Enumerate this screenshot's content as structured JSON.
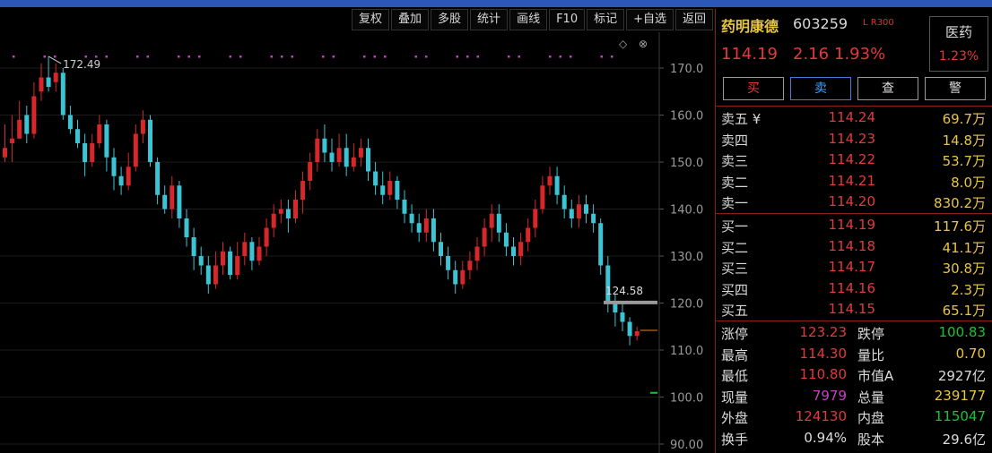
{
  "toolbar": [
    {
      "label": "复权",
      "icon": "",
      "name": "toolbar-fuquan-button"
    },
    {
      "label": "叠加",
      "icon": "",
      "name": "toolbar-overlay-button"
    },
    {
      "label": "多股",
      "icon": "",
      "name": "toolbar-multistock-button"
    },
    {
      "label": "统计",
      "icon": "",
      "name": "toolbar-stats-button"
    },
    {
      "label": "画线",
      "icon": "",
      "name": "toolbar-draw-button"
    },
    {
      "label": "F10",
      "icon": "",
      "name": "toolbar-f10-button"
    },
    {
      "label": "标记",
      "icon": "",
      "name": "toolbar-mark-button"
    },
    {
      "label": "自选",
      "icon": "+",
      "name": "toolbar-add-watchlist-button"
    },
    {
      "label": "返回",
      "icon": "",
      "name": "toolbar-back-button"
    }
  ],
  "chart_controls": {
    "diamond": "◇",
    "close": "⊗"
  },
  "chart_data": {
    "type": "candlestick",
    "y_ticks": [
      "170.0",
      "160.0",
      "150.0",
      "140.0",
      "130.0",
      "120.0",
      "110.0",
      "100.0",
      "90.00"
    ],
    "ylim": [
      90,
      172
    ],
    "max_label": "172.49",
    "min_label": "124.58",
    "colors": {
      "up": "#d8272b",
      "down": "#3cc3d4",
      "marker": "#c03ec0",
      "axis": "#3a3a3a",
      "price_line": "#e8832a",
      "reference": "#19c332"
    },
    "current_price": 114.19,
    "candles": [
      [
        151,
        153,
        158,
        150
      ],
      [
        154,
        155,
        160,
        150
      ],
      [
        155,
        159,
        163,
        155
      ],
      [
        160,
        156,
        162,
        154
      ],
      [
        156,
        164,
        167,
        155
      ],
      [
        165,
        168,
        171,
        163
      ],
      [
        168,
        166,
        172.49,
        165
      ],
      [
        167,
        169,
        171,
        165
      ],
      [
        169,
        160,
        170,
        159
      ],
      [
        160,
        157,
        162,
        156
      ],
      [
        157,
        154,
        159,
        153
      ],
      [
        154,
        150,
        156,
        147
      ],
      [
        150,
        154,
        156,
        149
      ],
      [
        154,
        158,
        160,
        153
      ],
      [
        158,
        151,
        159,
        148
      ],
      [
        151,
        147,
        153,
        144
      ],
      [
        147,
        145,
        149,
        143
      ],
      [
        145,
        149,
        152,
        144
      ],
      [
        149,
        156,
        158,
        148
      ],
      [
        156,
        159,
        161,
        154
      ],
      [
        159,
        150,
        160,
        149
      ],
      [
        150,
        143,
        151,
        141
      ],
      [
        143,
        140,
        145,
        139
      ],
      [
        140,
        145,
        147,
        138
      ],
      [
        145,
        138,
        146,
        136
      ],
      [
        138,
        134,
        140,
        132
      ],
      [
        134,
        130,
        136,
        127
      ],
      [
        130,
        128,
        132,
        126
      ],
      [
        128,
        124,
        130,
        122
      ],
      [
        124,
        128,
        131,
        123
      ],
      [
        128,
        131,
        133,
        126
      ],
      [
        131,
        126,
        132,
        125
      ],
      [
        126,
        130,
        133,
        125
      ],
      [
        130,
        133,
        135,
        128
      ],
      [
        133,
        129,
        134,
        127
      ],
      [
        129,
        132,
        134,
        128
      ],
      [
        132,
        136,
        138,
        130
      ],
      [
        136,
        139,
        141,
        134
      ],
      [
        139,
        140,
        142,
        137
      ],
      [
        140,
        138,
        142,
        135
      ],
      [
        138,
        142,
        144,
        137
      ],
      [
        142,
        146,
        148,
        139
      ],
      [
        146,
        150,
        152,
        144
      ],
      [
        150,
        155,
        157,
        148
      ],
      [
        155,
        152,
        158,
        150
      ],
      [
        152,
        150,
        155,
        148
      ],
      [
        150,
        153,
        156,
        149
      ],
      [
        153,
        149,
        156,
        147
      ],
      [
        149,
        151,
        154,
        148
      ],
      [
        151,
        153,
        155,
        149
      ],
      [
        153,
        148,
        155,
        146
      ],
      [
        148,
        145,
        150,
        143
      ],
      [
        145,
        143,
        148,
        141
      ],
      [
        143,
        146,
        148,
        142
      ],
      [
        146,
        142,
        147,
        140
      ],
      [
        142,
        139,
        144,
        137
      ],
      [
        139,
        137,
        141,
        135
      ],
      [
        137,
        135,
        139,
        133
      ],
      [
        135,
        138,
        140,
        133
      ],
      [
        138,
        133,
        140,
        131
      ],
      [
        133,
        130,
        135,
        128
      ],
      [
        130,
        127,
        132,
        125
      ],
      [
        127,
        124,
        129,
        122
      ],
      [
        124,
        127,
        129,
        123
      ],
      [
        127,
        129,
        131,
        125
      ],
      [
        129,
        132,
        134,
        127
      ],
      [
        132,
        136,
        138,
        130
      ],
      [
        136,
        139,
        141,
        133
      ],
      [
        139,
        135,
        141,
        133
      ],
      [
        135,
        132,
        137,
        130
      ],
      [
        132,
        130,
        134,
        128
      ],
      [
        130,
        133,
        135,
        128
      ],
      [
        133,
        136,
        138,
        131
      ],
      [
        136,
        140,
        142,
        134
      ],
      [
        140,
        145,
        147,
        139
      ],
      [
        145,
        147,
        149,
        143
      ],
      [
        147,
        143,
        149,
        141
      ],
      [
        143,
        140,
        145,
        138
      ],
      [
        140,
        138,
        142,
        136
      ],
      [
        138,
        141,
        143,
        136
      ],
      [
        141,
        139,
        143,
        137
      ],
      [
        139,
        137,
        141,
        135
      ],
      [
        137,
        128,
        138,
        126
      ],
      [
        128,
        120,
        130,
        118
      ],
      [
        120,
        118,
        122,
        115
      ],
      [
        118,
        116,
        120,
        114
      ],
      [
        116,
        113,
        117,
        111
      ],
      [
        113,
        114,
        115,
        112
      ]
    ]
  },
  "stock": {
    "name": "药明康德",
    "code": "603259",
    "flag": "L R300"
  },
  "sector": {
    "name": "医药",
    "change": "1.23%"
  },
  "quote": {
    "price": "114.19",
    "change": "2.16",
    "change_pct": "1.93%"
  },
  "trade_buttons": [
    {
      "label": "买",
      "name": "buy-button",
      "color": "#e23a3a"
    },
    {
      "label": "卖",
      "name": "sell-button",
      "color": "#3ea0ff"
    },
    {
      "label": "查",
      "name": "query-button",
      "color": "#dddddd"
    },
    {
      "label": "警",
      "name": "alert-button",
      "color": "#dddddd"
    }
  ],
  "sell_orders": [
    {
      "label": "卖五 ¥",
      "price": "114.24",
      "volume": "69.7万"
    },
    {
      "label": "卖四",
      "price": "114.23",
      "volume": "14.8万"
    },
    {
      "label": "卖三",
      "price": "114.22",
      "volume": "53.7万"
    },
    {
      "label": "卖二",
      "price": "114.21",
      "volume": "8.0万"
    },
    {
      "label": "卖一",
      "price": "114.20",
      "volume": "830.2万"
    }
  ],
  "buy_orders": [
    {
      "label": "买一",
      "price": "114.19",
      "volume": "117.6万"
    },
    {
      "label": "买二",
      "price": "114.18",
      "volume": "41.1万"
    },
    {
      "label": "买三",
      "price": "114.17",
      "volume": "30.8万"
    },
    {
      "label": "买四",
      "price": "114.16",
      "volume": "2.3万"
    },
    {
      "label": "买五",
      "price": "114.15",
      "volume": "65.1万"
    }
  ],
  "stats": [
    {
      "l1": "涨停",
      "v1": "123.23",
      "c1": "red",
      "l2": "跌停",
      "v2": "100.83",
      "c2": "green"
    },
    {
      "l1": "最高",
      "v1": "114.30",
      "c1": "red",
      "l2": "量比",
      "v2": "0.70",
      "c2": "yellow"
    },
    {
      "l1": "最低",
      "v1": "110.80",
      "c1": "red",
      "l2": "市值A",
      "v2": "2927亿",
      "c2": "white"
    },
    {
      "l1": "现量",
      "v1": "7979",
      "c1": "magenta",
      "l2": "总量",
      "v2": "239177",
      "c2": "yellow"
    },
    {
      "l1": "外盘",
      "v1": "124130",
      "c1": "red",
      "l2": "内盘",
      "v2": "115047",
      "c2": "green"
    },
    {
      "l1": "换手",
      "v1": "0.94%",
      "c1": "white",
      "l2": "股本",
      "v2": "29.6亿",
      "c2": "white"
    }
  ]
}
